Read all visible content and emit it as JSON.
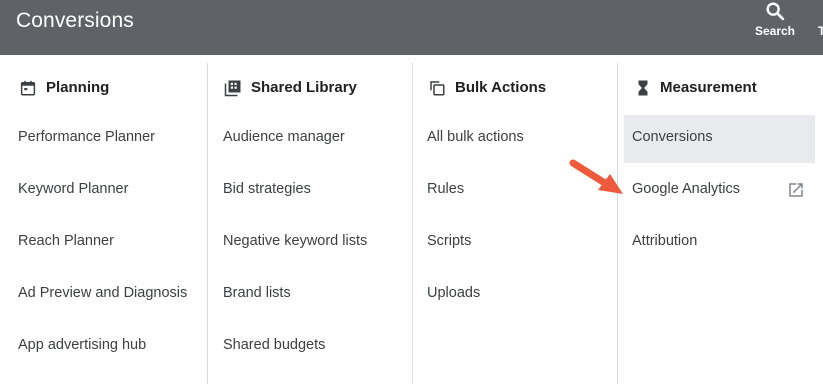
{
  "header": {
    "title": "Conversions",
    "search_label": "Search",
    "cut_label": "T"
  },
  "columns": [
    {
      "title": "Planning",
      "icon": "calendar-icon",
      "items": [
        "Performance Planner",
        "Keyword Planner",
        "Reach Planner",
        "Ad Preview and Diagnosis",
        "App advertising hub"
      ]
    },
    {
      "title": "Shared Library",
      "icon": "library-grid-icon",
      "items": [
        "Audience manager",
        "Bid strategies",
        "Negative keyword lists",
        "Brand lists",
        "Shared budgets"
      ]
    },
    {
      "title": "Bulk Actions",
      "icon": "copy-stack-icon",
      "items": [
        "All bulk actions",
        "Rules",
        "Scripts",
        "Uploads"
      ]
    },
    {
      "title": "Measurement",
      "icon": "hourglass-icon",
      "items": [
        "Conversions",
        "Google Analytics",
        "Attribution"
      ],
      "selected": "Conversions",
      "external_item": "Google Analytics"
    }
  ],
  "annotation": {
    "arrow_color": "#ef5a3c"
  },
  "colors": {
    "header_bg": "#5f6368",
    "selected_bg": "#e8eaed",
    "divider": "#dadce0"
  }
}
